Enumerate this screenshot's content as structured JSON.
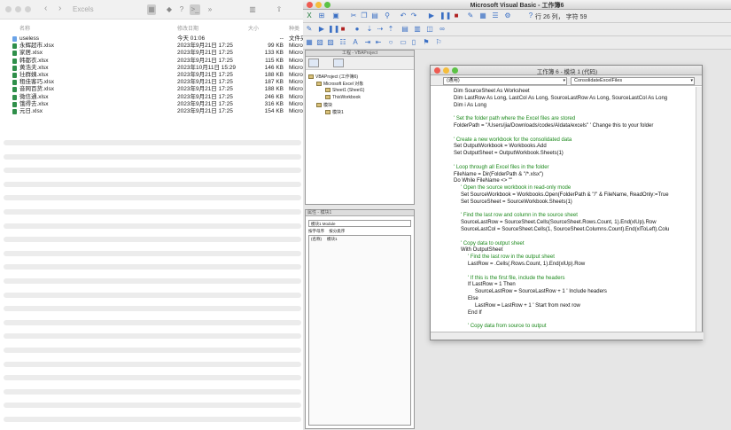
{
  "finder": {
    "path": "Excels",
    "headers": {
      "name": "名称",
      "date": "修改日期",
      "size": "大小",
      "kind": "种类"
    },
    "rows": [
      {
        "name": "useless",
        "date": "今天 01:06",
        "size": "--",
        "kind": "文件夹",
        "folder": true
      },
      {
        "name": "永辉超市.xlsx",
        "date": "2023年9月21日 17:25",
        "size": "99 KB",
        "kind": "Micro"
      },
      {
        "name": "家居.xlsx",
        "date": "2023年9月21日 17:25",
        "size": "133 KB",
        "kind": "Micro"
      },
      {
        "name": "韩都衣.xlsx",
        "date": "2023年9月21日 17:25",
        "size": "115 KB",
        "kind": "Micro"
      },
      {
        "name": "黄浩夫.xlsx",
        "date": "2023年10月11日 15:29",
        "size": "146 KB",
        "kind": "Micro"
      },
      {
        "name": "壮群姨.xlsx",
        "date": "2023年9月21日 17:25",
        "size": "188 KB",
        "kind": "Micro"
      },
      {
        "name": "租佳客巧.xlsx",
        "date": "2023年9月21日 17:25",
        "size": "187 KB",
        "kind": "Micro"
      },
      {
        "name": "音网百货.xlsx",
        "date": "2023年9月21日 17:25",
        "size": "188 KB",
        "kind": "Micro"
      },
      {
        "name": "微信通.xlsx",
        "date": "2023年9月21日 17:25",
        "size": "246 KB",
        "kind": "Micro"
      },
      {
        "name": "饿得去.xlsx",
        "date": "2023年9月21日 17:25",
        "size": "316 KB",
        "kind": "Micro"
      },
      {
        "name": "元日.xlsx",
        "date": "2023年9月21日 17:25",
        "size": "154 KB",
        "kind": "Micro"
      }
    ]
  },
  "vbe": {
    "title": "Microsoft Visual Basic - 工作簿6",
    "cursor_pos": "行 26 列， 字符 59",
    "project": {
      "title": "工程 - VBAProject",
      "root": "VBAProject (工作簿6)",
      "items": [
        "Microsoft Excel 对象",
        "Sheet1 (Sheet1)",
        "ThisWorkbook",
        "模块",
        "模块1"
      ]
    },
    "properties": {
      "title": "属性 - 模块1",
      "combo": "模块1 Module",
      "tabs": [
        "按字母序",
        "按分类序"
      ],
      "row_name": "(名称)",
      "row_value": "模块1"
    },
    "code_window": {
      "title": "工作簿 6 - 模块 1 (代码)",
      "object_combo": "(通用)",
      "proc_combo": "ConsolidateExcelFiles"
    }
  },
  "code_lines": [
    {
      "text": "Dim SourceSheet As Worksheet",
      "type": "code",
      "indent": 0
    },
    {
      "text": "Dim LastRow As Long, LastCol As Long, SourceLastRow As Long, SourceLastCol As Long",
      "type": "code",
      "indent": 0
    },
    {
      "text": "Dim i As Long",
      "type": "code",
      "indent": 0
    },
    {
      "text": "",
      "type": "code",
      "indent": 0
    },
    {
      "text": "' Set the folder path where the Excel files are stored",
      "type": "cmt",
      "indent": 0
    },
    {
      "text": "FolderPath = \"/Users/jia/Downloads/codes/AIdata/excels\" ' Change this to your folder",
      "type": "code",
      "indent": 0
    },
    {
      "text": "",
      "type": "code",
      "indent": 0
    },
    {
      "text": "' Create a new workbook for the consolidated data",
      "type": "cmt",
      "indent": 0
    },
    {
      "text": "Set OutputWorkbook = Workbooks.Add",
      "type": "code",
      "indent": 0
    },
    {
      "text": "Set OutputSheet = OutputWorkbook.Sheets(1)",
      "type": "code",
      "indent": 0
    },
    {
      "text": "",
      "type": "code",
      "indent": 0
    },
    {
      "text": "' Loop through all Excel files in the folder",
      "type": "cmt",
      "indent": 0
    },
    {
      "text": "FileName = Dir(FolderPath & \"/*.xlsx\")",
      "type": "code",
      "indent": 0
    },
    {
      "text": "Do While FileName <> \"\"",
      "type": "code",
      "indent": 0
    },
    {
      "text": "' Open the source workbook in read-only mode",
      "type": "cmt",
      "indent": 1
    },
    {
      "text": "Set SourceWorkbook = Workbooks.Open(FolderPath & \"/\" & FileName, ReadOnly:=True",
      "type": "code",
      "indent": 1
    },
    {
      "text": "Set SourceSheet = SourceWorkbook.Sheets(1)",
      "type": "code",
      "indent": 1
    },
    {
      "text": "",
      "type": "code",
      "indent": 0
    },
    {
      "text": "' Find the last row and column in the source sheet",
      "type": "cmt",
      "indent": 1
    },
    {
      "text": "SourceLastRow = SourceSheet.Cells(SourceSheet.Rows.Count, 1).End(xlUp).Row",
      "type": "code",
      "indent": 1
    },
    {
      "text": "SourceLastCol = SourceSheet.Cells(1, SourceSheet.Columns.Count).End(xlToLeft).Colu",
      "type": "code",
      "indent": 1
    },
    {
      "text": "",
      "type": "code",
      "indent": 0
    },
    {
      "text": "' Copy data to output sheet",
      "type": "cmt",
      "indent": 1
    },
    {
      "text": "With OutputSheet",
      "type": "code",
      "indent": 1
    },
    {
      "text": "' Find the last row in the output sheet",
      "type": "cmt",
      "indent": 2
    },
    {
      "text": "LastRow = .Cells(.Rows.Count, 1).End(xlUp).Row",
      "type": "code",
      "indent": 2
    },
    {
      "text": "",
      "type": "code",
      "indent": 0
    },
    {
      "text": "' If this is the first file, include the headers",
      "type": "cmt",
      "indent": 2
    },
    {
      "text": "If LastRow = 1 Then",
      "type": "code",
      "indent": 2
    },
    {
      "text": "SourceLastRow = SourceLastRow + 1 ' Include headers",
      "type": "code",
      "indent": 3
    },
    {
      "text": "Else",
      "type": "code",
      "indent": 2
    },
    {
      "text": "LastRow = LastRow + 1 ' Start from next row",
      "type": "code",
      "indent": 3
    },
    {
      "text": "End If",
      "type": "code",
      "indent": 2
    },
    {
      "text": "",
      "type": "code",
      "indent": 0
    },
    {
      "text": "' Copy data from source to output",
      "type": "cmt",
      "indent": 2
    }
  ]
}
